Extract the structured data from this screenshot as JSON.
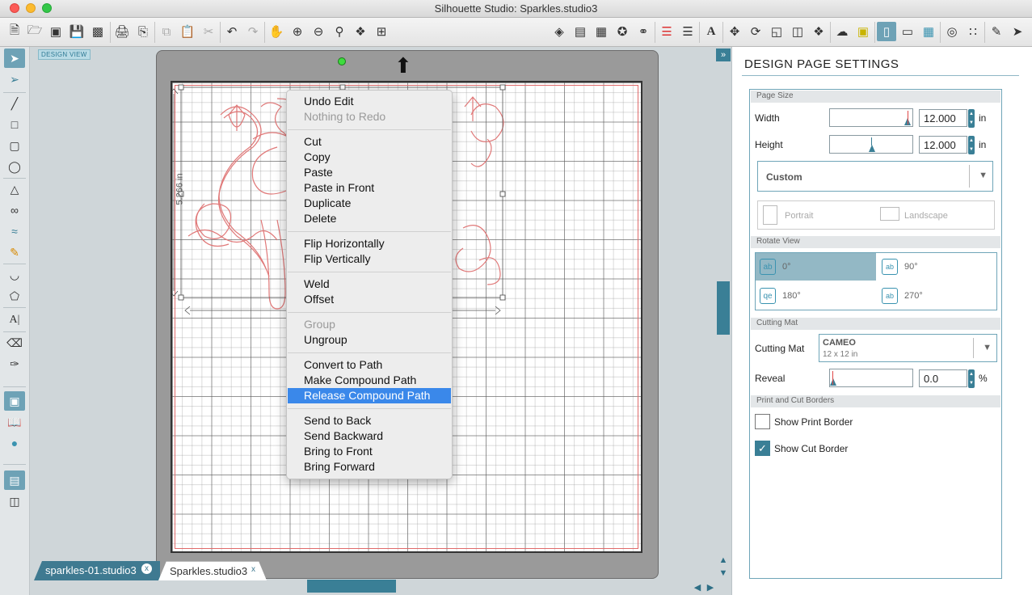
{
  "window": {
    "title": "Silhouette Studio: Sparkles.studio3",
    "traffic": {
      "close": "#fc5b57",
      "minimize": "#fcbb2f",
      "zoom": "#33c748"
    }
  },
  "toolbar": {
    "icons": [
      "new-document",
      "open-folder",
      "open-library",
      "save",
      "save-to-library",
      "print",
      "print-cut",
      "copy",
      "paste",
      "cut",
      "undo",
      "redo",
      "pan-hand",
      "zoom-in",
      "zoom-out",
      "zoom-select",
      "zoom-fit",
      "fit-page",
      "fill-color",
      "fill-gradient",
      "fill-pattern",
      "line-color",
      "line-style",
      "line-style-2",
      "text-style",
      "transform",
      "rotate",
      "scale",
      "align",
      "replicate",
      "offset-tool",
      "trace",
      "library-icon-1",
      "page-settings",
      "cut-settings",
      "grid",
      "registration",
      "spiral",
      "design-store",
      "send-cut"
    ],
    "selected_icon": "page-settings"
  },
  "left_tools": [
    "select-arrow",
    "edit-points",
    "line-tool",
    "rectangle-tool",
    "rounded-rect-tool",
    "ellipse-tool",
    "polygon-tool",
    "curve-tool",
    "freehand-tool",
    "sketch-pen-tool",
    "arc-tool",
    "regular-polygon-tool",
    "text-tool",
    "eraser-tool",
    "knife-tool",
    "design-view",
    "library-view",
    "store-view",
    "panel-toggle-1",
    "panel-toggle-2"
  ],
  "workspace": {
    "design_view_tag": "DESIGN VIEW",
    "dimension_label": "5.266 in"
  },
  "tabs": [
    {
      "label": "sparkles-01.studio3",
      "close": "x"
    },
    {
      "label": "Sparkles.studio3",
      "close": "x"
    }
  ],
  "context_menu": {
    "items": [
      {
        "label": "Undo Edit",
        "state": "enabled"
      },
      {
        "label": "Nothing to Redo",
        "state": "disabled"
      },
      {
        "label": "Cut",
        "state": "enabled"
      },
      {
        "label": "Copy",
        "state": "enabled"
      },
      {
        "label": "Paste",
        "state": "enabled"
      },
      {
        "label": "Paste in Front",
        "state": "enabled"
      },
      {
        "label": "Duplicate",
        "state": "enabled"
      },
      {
        "label": "Delete",
        "state": "enabled"
      },
      {
        "label": "Flip Horizontally",
        "state": "enabled"
      },
      {
        "label": "Flip Vertically",
        "state": "enabled"
      },
      {
        "label": "Weld",
        "state": "enabled"
      },
      {
        "label": "Offset",
        "state": "enabled"
      },
      {
        "label": "Group",
        "state": "disabled"
      },
      {
        "label": "Ungroup",
        "state": "enabled"
      },
      {
        "label": "Convert to Path",
        "state": "enabled"
      },
      {
        "label": "Make Compound Path",
        "state": "enabled"
      },
      {
        "label": "Release Compound Path",
        "state": "highlighted"
      },
      {
        "label": "Send to Back",
        "state": "enabled"
      },
      {
        "label": "Send Backward",
        "state": "enabled"
      },
      {
        "label": "Bring to Front",
        "state": "enabled"
      },
      {
        "label": "Bring Forward",
        "state": "enabled"
      }
    ]
  },
  "panel": {
    "title": "DESIGN PAGE SETTINGS",
    "page_size": {
      "section": "Page Size",
      "width_label": "Width",
      "width_value": "12.000",
      "height_label": "Height",
      "height_value": "12.000",
      "unit": "in",
      "preset": "Custom",
      "portrait": "Portrait",
      "landscape": "Landscape"
    },
    "rotate_view": {
      "section": "Rotate View",
      "options": [
        "0°",
        "90°",
        "180°",
        "270°"
      ],
      "selected": "0°"
    },
    "cutting_mat": {
      "section": "Cutting Mat",
      "label": "Cutting Mat",
      "mat_name": "CAMEO",
      "mat_size": "12 x 12 in",
      "reveal_label": "Reveal",
      "reveal_value": "0.0",
      "reveal_unit": "%"
    },
    "borders": {
      "section": "Print and Cut Borders",
      "print_border_label": "Show Print Border",
      "print_border_checked": false,
      "cut_border_label": "Show Cut Border",
      "cut_border_checked": true
    }
  },
  "colors": {
    "accent": "#3a7f96",
    "selected_tool": "#6ea2b6",
    "menu_highlight": "#3a88ea",
    "design_stroke": "#e07878"
  }
}
